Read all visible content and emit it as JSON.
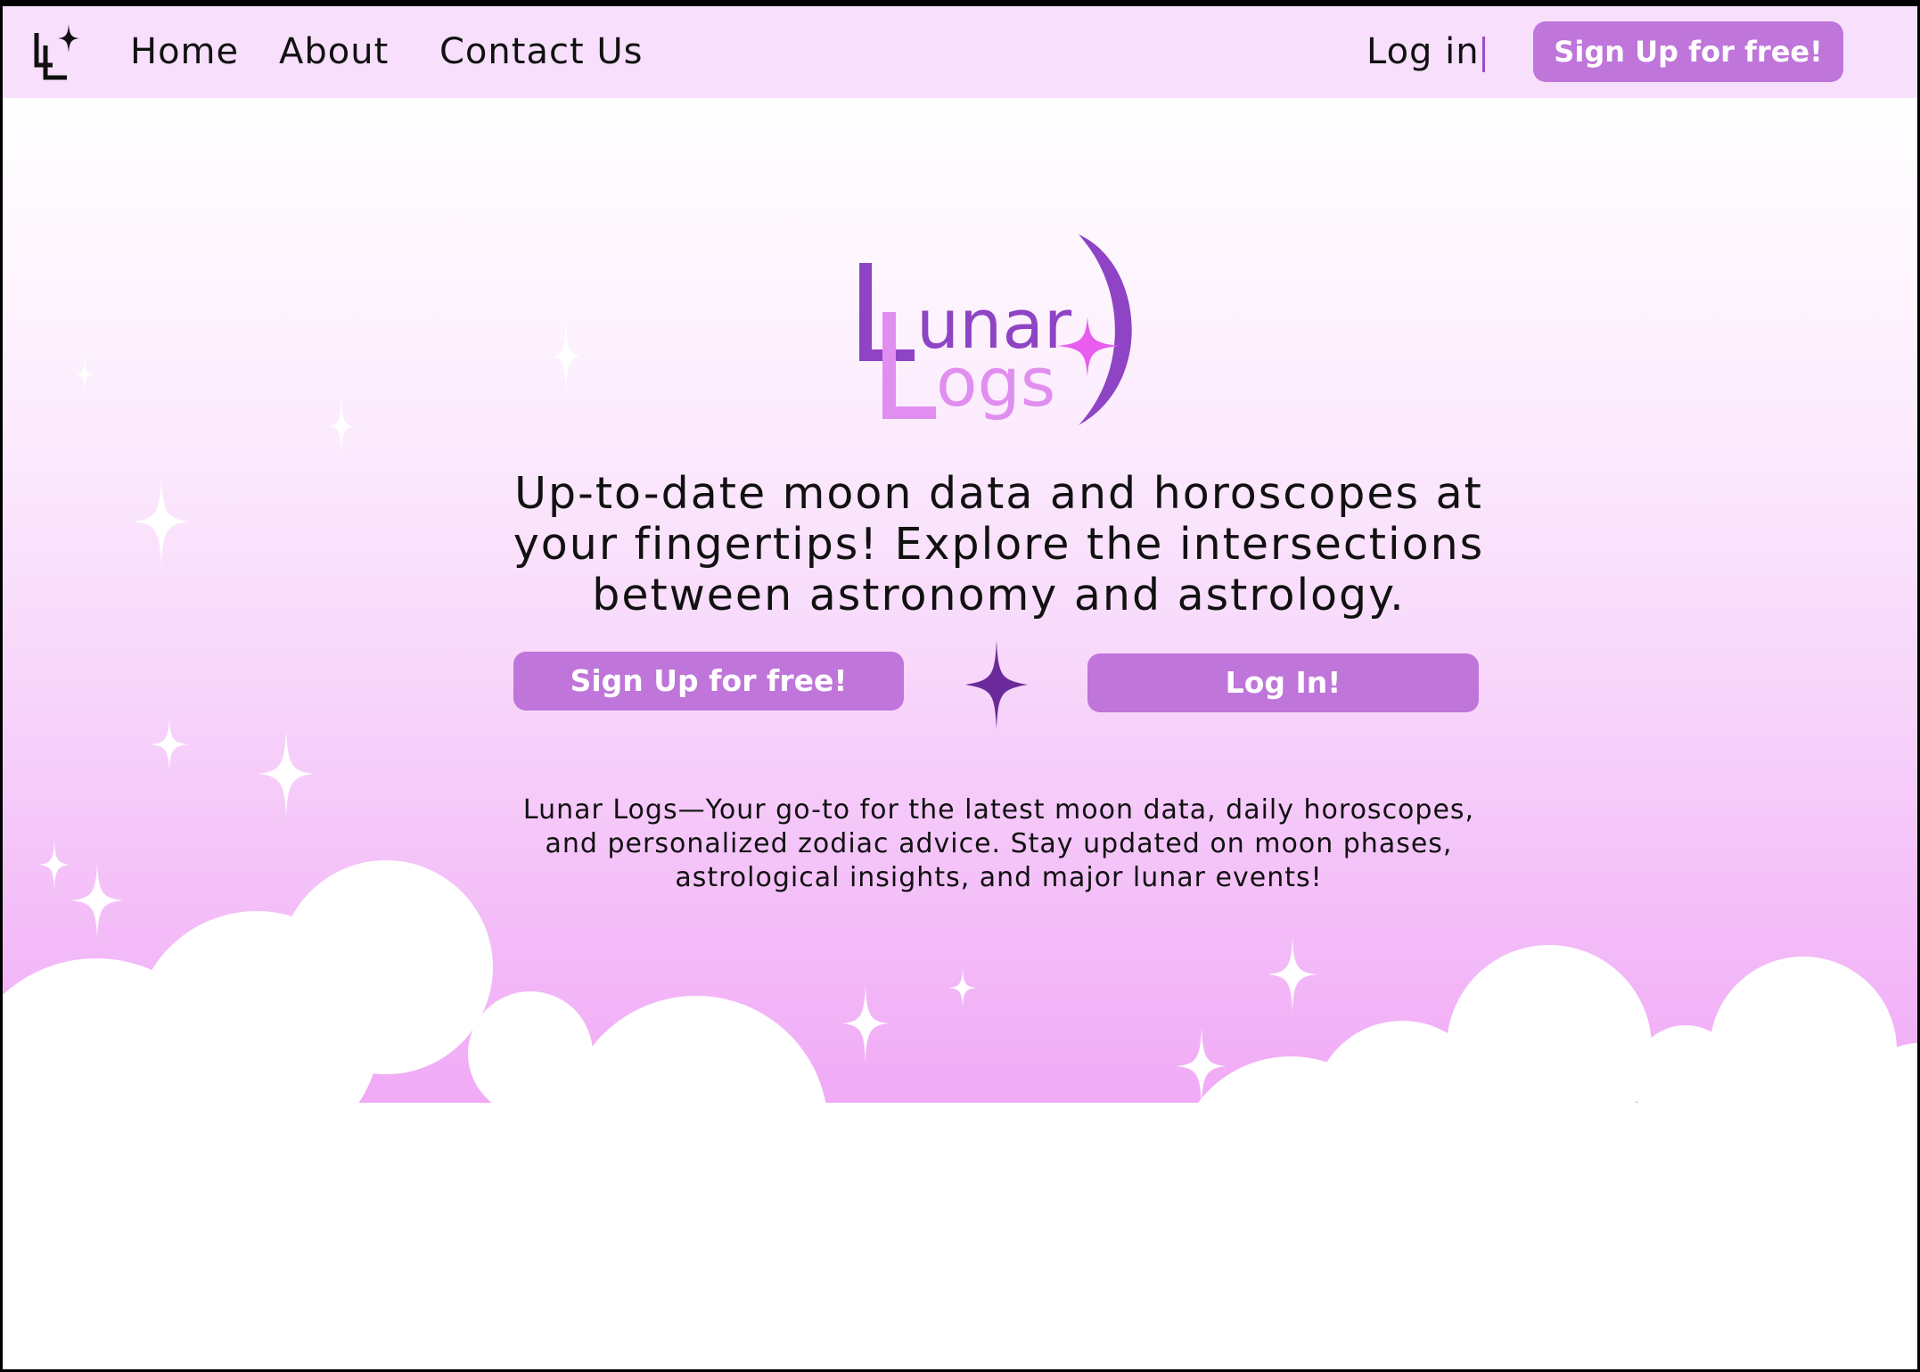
{
  "nav": {
    "home": "Home",
    "about": "About",
    "contact": "Contact Us",
    "login": "Log in",
    "signup": "Sign Up for free!"
  },
  "logo": {
    "line1": "unar",
    "line2": "ogs"
  },
  "hero": {
    "tagline": "Up-to-date moon data and horoscopes at your fingertips! Explore the intersections between astronomy and astrology.",
    "signup_button": "Sign Up for free!",
    "login_button": "Log In!",
    "description": "Lunar Logs—Your go-to for the latest moon data, daily horoscopes, and personalized zodiac advice. Stay updated on moon phases, astrological insights, and major lunar events!"
  },
  "colors": {
    "nav_bg": "#f8e0fc",
    "button": "#bf75d9",
    "logo_dark": "#8e44c4",
    "logo_light": "#e08ef0",
    "star_pink": "#e85cf0",
    "star_dark": "#6b2a9a"
  },
  "icons": {
    "nav_logo": "lunar-logs-monogram-icon",
    "logo_star": "sparkle-star-icon",
    "logo_moon": "crescent-moon-icon",
    "divider_star": "sparkle-star-icon"
  }
}
